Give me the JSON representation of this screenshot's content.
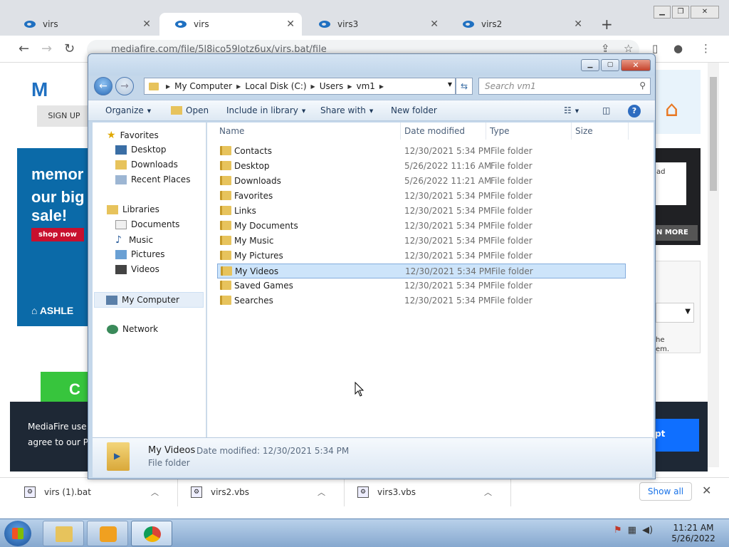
{
  "browser": {
    "tabs": [
      {
        "label": "virs",
        "active": false
      },
      {
        "label": "virs",
        "active": true
      },
      {
        "label": "virs3",
        "active": false
      },
      {
        "label": "virs2",
        "active": false
      }
    ],
    "url": "mediafire.com/file/5l8ico59lotz6ux/virs.bat/file"
  },
  "page": {
    "logo": "M",
    "signup": "SIGN UP",
    "ad_line1": "memor",
    "ad_line2": "our big",
    "ad_line3": "sale!",
    "ad_shop": "shop now",
    "ad_brand": "⌂ ASHLE",
    "green_btn": "C",
    "cookie_line1": "MediaFire use",
    "cookie_line2": "agree to our P",
    "accept": "pt",
    "right_ad_text": "ad",
    "right_more": "N MORE",
    "right_text1": "he",
    "right_text2": "em."
  },
  "explorer": {
    "breadcrumbs": [
      "My Computer",
      "Local Disk (C:)",
      "Users",
      "vm1"
    ],
    "search_placeholder": "Search vm1",
    "commands": {
      "organize": "Organize",
      "open": "Open",
      "include": "Include in library",
      "share": "Share with",
      "newfolder": "New folder"
    },
    "nav": {
      "favorites": "Favorites",
      "desktop": "Desktop",
      "downloads": "Downloads",
      "recent": "Recent Places",
      "libraries": "Libraries",
      "documents": "Documents",
      "music": "Music",
      "pictures": "Pictures",
      "videos": "Videos",
      "computer": "My Computer",
      "network": "Network"
    },
    "columns": {
      "name": "Name",
      "date": "Date modified",
      "type": "Type",
      "size": "Size"
    },
    "rows": [
      {
        "name": "Contacts",
        "date": "12/30/2021 5:34 PM",
        "type": "File folder"
      },
      {
        "name": "Desktop",
        "date": "5/26/2022 11:16 AM",
        "type": "File folder"
      },
      {
        "name": "Downloads",
        "date": "5/26/2022 11:21 AM",
        "type": "File folder"
      },
      {
        "name": "Favorites",
        "date": "12/30/2021 5:34 PM",
        "type": "File folder"
      },
      {
        "name": "Links",
        "date": "12/30/2021 5:34 PM",
        "type": "File folder"
      },
      {
        "name": "My Documents",
        "date": "12/30/2021 5:34 PM",
        "type": "File folder"
      },
      {
        "name": "My Music",
        "date": "12/30/2021 5:34 PM",
        "type": "File folder"
      },
      {
        "name": "My Pictures",
        "date": "12/30/2021 5:34 PM",
        "type": "File folder"
      },
      {
        "name": "My Videos",
        "date": "12/30/2021 5:34 PM",
        "type": "File folder"
      },
      {
        "name": "Saved Games",
        "date": "12/30/2021 5:34 PM",
        "type": "File folder"
      },
      {
        "name": "Searches",
        "date": "12/30/2021 5:34 PM",
        "type": "File folder"
      }
    ],
    "selected_row": 8,
    "details": {
      "name": "My Videos",
      "meta": "Date modified: 12/30/2021 5:34 PM",
      "type": "File folder"
    }
  },
  "downloads": {
    "items": [
      "virs (1).bat",
      "virs2.vbs",
      "virs3.vbs"
    ],
    "show_all": "Show all"
  },
  "taskbar": {
    "time": "11:21 AM",
    "date": "5/26/2022"
  }
}
